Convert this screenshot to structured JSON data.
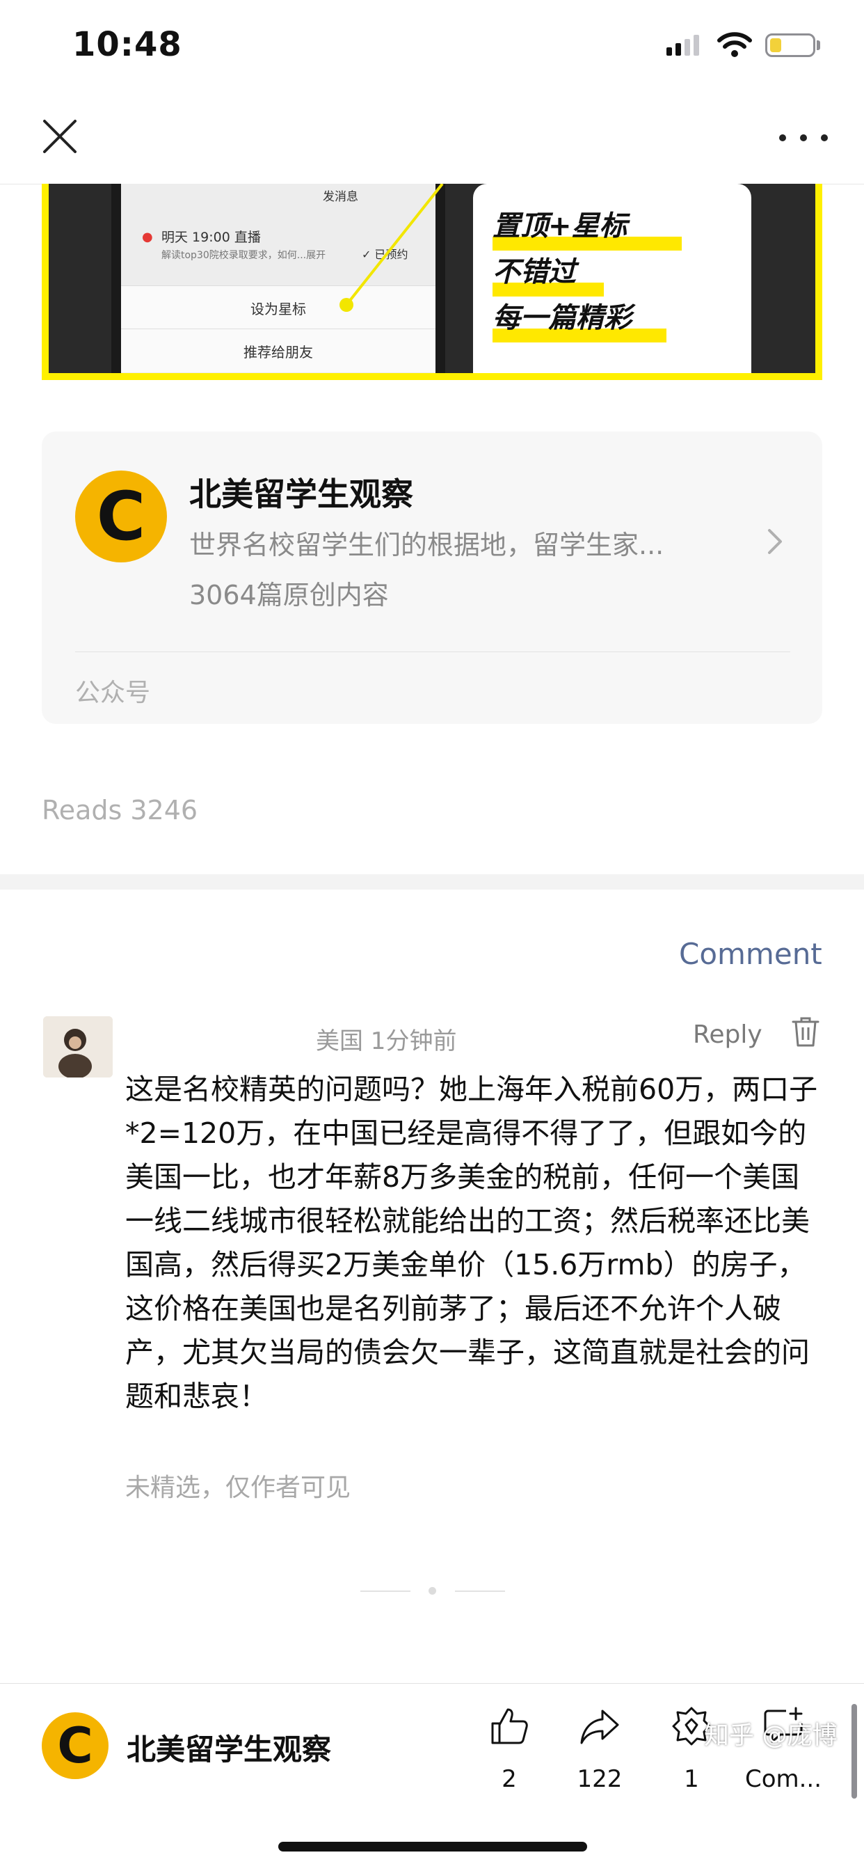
{
  "status_bar": {
    "time": "10:48",
    "battery_color": "#f2d13a"
  },
  "nav": {
    "close_icon": "close-icon",
    "more_icon": "more-horizontal-icon"
  },
  "banner": {
    "phone_top_text": "发消息",
    "phone_schedule": "明天 19:00 直播",
    "phone_schedule_sub": "解读top30院校录取要求，如何...展开",
    "phone_reserved": "✓ 已预约",
    "menu_star": "设为星标",
    "menu_recommend": "推荐给朋友",
    "promo_line1": "置顶+星标",
    "promo_line2": "不错过",
    "promo_line3": "每一篇精彩"
  },
  "account_card": {
    "avatar_letter": "C",
    "name": "北美留学生观察",
    "description": "世界名校留学生们的根据地，留学生家...",
    "article_count": "3064篇原创内容",
    "type": "公众号"
  },
  "reads": "Reads 3246",
  "comment_link": "Comment",
  "comment": {
    "meta": "美国 1分钟前",
    "reply_label": "Reply",
    "text": "这是名校精英的问题吗？她上海年入税前60万，两口子*2=120万，在中国已经是高得不得了了，但跟如今的美国一比，也才年薪8万多美金的税前，任何一个美国一线二线城市很轻松就能给出的工资；然后税率还比美国高，然后得买2万美金单价（15.6万rmb）的房子，这价格在美国也是名列前茅了；最后还不允许个人破产，尤其欠当局的债会欠一辈子，这简直就是社会的问题和悲哀！",
    "note": "未精选，仅作者可见"
  },
  "bottom_bar": {
    "account_name": "北美留学生观察",
    "avatar_letter": "C",
    "like_count": "2",
    "share_count": "122",
    "wow_count": "1",
    "comment_label": "Com..."
  },
  "watermark": "知乎 @庞博",
  "colors": {
    "accent_link": "#576b95",
    "brand_yellow": "#f5b400",
    "banner_yellow": "#fff000"
  }
}
